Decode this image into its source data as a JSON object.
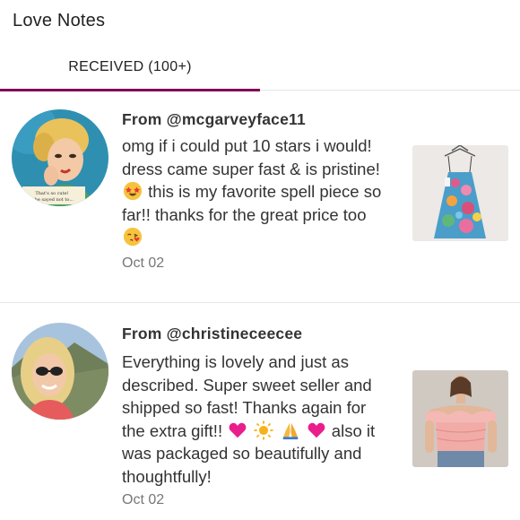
{
  "header": {
    "title": "Love Notes"
  },
  "tabs": [
    {
      "label": "RECEIVED (100+)",
      "active": true
    }
  ],
  "accent_color": "#7f0353",
  "notes": [
    {
      "from": "From @mcgarveyface11",
      "message_part1": "omg if i could put 10 stars i would! dress came super fast & is pristine!",
      "message_part2": "this is my favorite spell piece so far!! thanks for the great price too",
      "emojis": [
        "star-struck-emoji",
        "face-blowing-kiss-emoji"
      ],
      "date": "Oct 02",
      "avatar_caption_line1": "That's so cute!",
      "avatar_caption_line2": "...he sayed not to...",
      "thumbnail": "floral-dress-on-hanger"
    },
    {
      "from": "From @christineceecee",
      "message_part1": "Everything is lovely and just as described. Super sweet seller and shipped so fast! Thanks again for the extra gift!!",
      "message_part2": "also it was packaged so beautifully and thoughtfully!",
      "emojis": [
        "pink-heart-emoji",
        "sun-emoji",
        "folded-hands-emoji",
        "pink-heart-emoji"
      ],
      "date": "Oct 02",
      "thumbnail": "pink-ruffle-top-model"
    }
  ]
}
